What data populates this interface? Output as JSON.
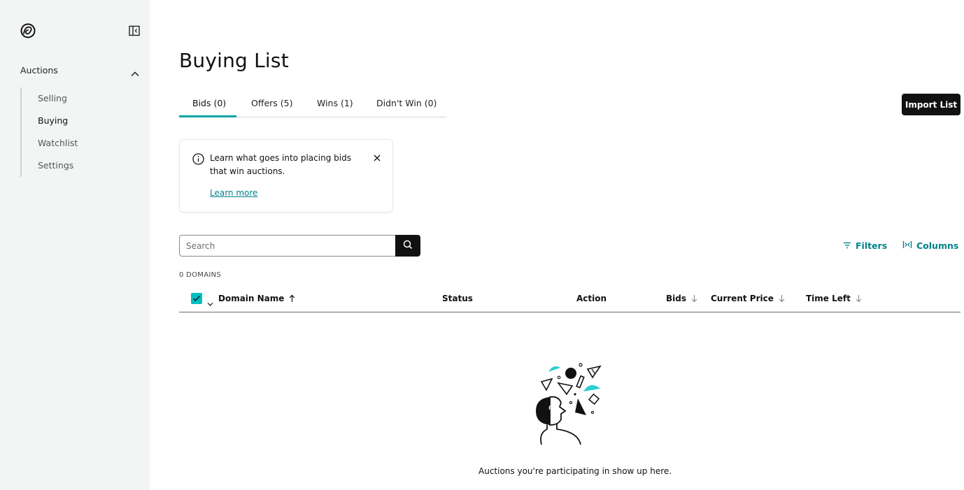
{
  "sidebar": {
    "logo_icon": "godaddy-logo-icon",
    "collapse_icon": "sidebar-collapse-icon",
    "section_label": "Auctions",
    "section_chevron_icon": "chevron-up-icon",
    "items": [
      {
        "label": "Selling",
        "active": false
      },
      {
        "label": "Buying",
        "active": true
      },
      {
        "label": "Watchlist",
        "active": false
      },
      {
        "label": "Settings",
        "active": false
      }
    ]
  },
  "page": {
    "title": "Buying List"
  },
  "tabs": [
    {
      "label": "Bids (0)",
      "active": true
    },
    {
      "label": "Offers (5)",
      "active": false
    },
    {
      "label": "Wins (1)",
      "active": false
    },
    {
      "label": "Didn't Win (0)",
      "active": false
    }
  ],
  "toolbar": {
    "import_label": "Import List"
  },
  "info_card": {
    "icon": "info-icon",
    "text": "Learn what goes into placing bids that win auctions.",
    "link_label": "Learn more",
    "close_icon": "close-icon"
  },
  "search": {
    "placeholder": "Search",
    "value": "",
    "icon": "search-icon"
  },
  "filters": {
    "filters_label": "Filters",
    "columns_label": "Columns"
  },
  "table": {
    "count_label": "0 DOMAINS",
    "columns": [
      {
        "label": "Domain Name",
        "sort": "ascending"
      },
      {
        "label": "Status",
        "sort": null
      },
      {
        "label": "Action",
        "sort": null
      },
      {
        "label": "Bids",
        "sort": "descending"
      },
      {
        "label": "Current Price",
        "sort": "descending"
      },
      {
        "label": "Time Left",
        "sort": "descending"
      }
    ],
    "rows": []
  },
  "empty_state": {
    "illustration": "person-thinking-shapes-illustration",
    "message": "Auctions you're participating in show up here."
  },
  "colors": {
    "accent": "#00a4a6",
    "link": "#00838a",
    "checkbox": "#00bfc3",
    "sidebar_bg": "#f3f5f5",
    "primary_button": "#111111"
  }
}
